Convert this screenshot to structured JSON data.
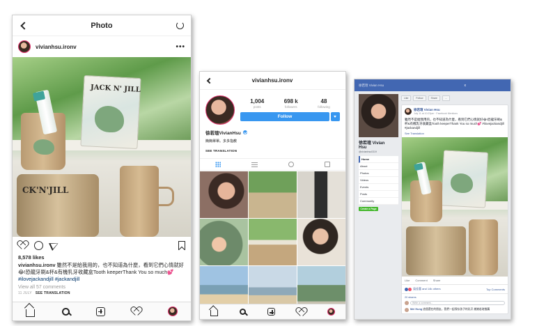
{
  "shot1": {
    "nav_title": "Photo",
    "username": "vivianhsu.ironv",
    "photo_labels": {
      "pack": "JACK N' JILL",
      "cup": "CK'N'JILL"
    },
    "likes": "8,578 likes",
    "caption_user": "vivianhsu.ironv",
    "caption_text": " 雖然不是給我用的，也不知道為什麼，看到它們心情就好😂!恐龍牙刷&杯&有機乳牙收藏盒Tooth keeperThank You so much💕",
    "caption_hashtag": "#ilovejackandjill #jackandjill",
    "view_all": "View all 57 comments",
    "date": "11 JULY",
    "see_translation": "SEE TRANSLATION"
  },
  "shot2": {
    "nav_title": "vivianhsu.ironv",
    "stats": [
      {
        "num": "1,004",
        "label": "posts"
      },
      {
        "num": "698 k",
        "label": "followers"
      },
      {
        "num": "48",
        "label": "following"
      }
    ],
    "follow_label": "Follow",
    "display_name": "徐若瑄VivianHsu",
    "bio": "簡簡單單。多多指教",
    "see_translation": "SEE TRANSLATION"
  },
  "shot3": {
    "top_title": "徐若瑄 Vivian Hsu",
    "close": "x",
    "page_name": "徐若瑄 Vivian",
    "page_name_2": "Hsu",
    "handle": "@vivianhsu0319",
    "menu": [
      "Home",
      "About",
      "Photos",
      "Videos",
      "Events",
      "Posts",
      "Community"
    ],
    "create_page": "Create a Page",
    "page_buttons": [
      "Like",
      "Follow",
      "Share",
      "..."
    ],
    "post_author": "徐若瑄 Vivian Hsu",
    "post_time": "July 11 at 10:23pm · Facebook Mentions",
    "post_text": "雖然不是給我用的，也不知道為什麼，看到它們心情就好😂!恐龍牙刷&杯&有機乳牙收藏盒Tooth keeperThank You so much💕 #ilovejackandjill #jackandjill",
    "see_translation": "See Translation",
    "actions": [
      "Like",
      "Comment",
      "Share"
    ],
    "likes_text": "吳佳蓉 and 14k others",
    "top_comments": "Top Comments",
    "shares": "20 shares",
    "comment_placeholder": "Write a comment...",
    "comment_user": "Mei Hung",
    "comment_text": " 這個還在的朋友，我們一起保存孩子的乳牙 謝謝若瑄推薦"
  }
}
